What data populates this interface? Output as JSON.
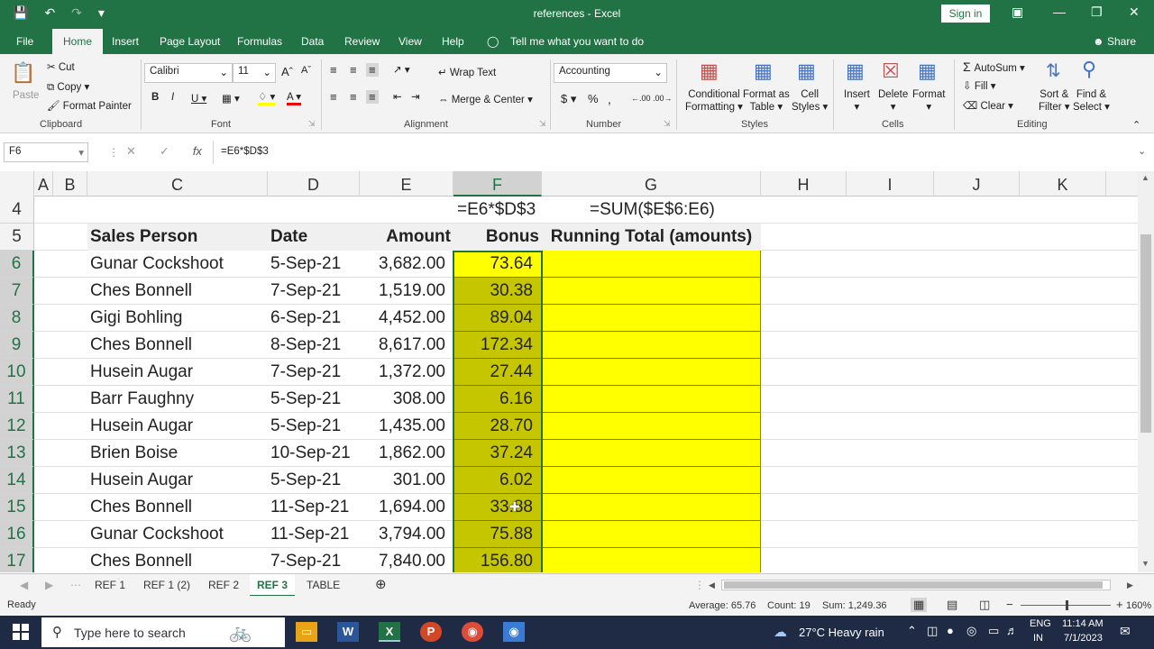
{
  "title": {
    "filename": "references",
    "app": "Excel",
    "full": "references - Excel",
    "signin": "Sign in"
  },
  "ribbon_tabs": [
    "File",
    "Home",
    "Insert",
    "Page Layout",
    "Formulas",
    "Data",
    "Review",
    "View",
    "Help",
    "Tell me what you want to do",
    "Share"
  ],
  "ribbon": {
    "clipboard": {
      "paste": "Paste",
      "cut": "Cut",
      "copy": "Copy",
      "format_painter": "Format Painter",
      "label": "Clipboard"
    },
    "font": {
      "name": "Calibri",
      "size": "11",
      "label": "Font"
    },
    "alignment": {
      "wrap": "Wrap Text",
      "merge": "Merge & Center",
      "label": "Alignment"
    },
    "number": {
      "format": "Accounting",
      "label": "Number"
    },
    "styles": {
      "cond1": "Conditional",
      "cond2": "Formatting",
      "table1": "Format as",
      "table2": "Table",
      "cell1": "Cell",
      "cell2": "Styles",
      "label": "Styles"
    },
    "cells": {
      "insert": "Insert",
      "delete": "Delete",
      "format": "Format",
      "label": "Cells"
    },
    "editing": {
      "autosum": "AutoSum",
      "fill": "Fill",
      "clear": "Clear",
      "sort1": "Sort &",
      "sort2": "Filter",
      "find1": "Find &",
      "find2": "Select",
      "label": "Editing"
    }
  },
  "namebox": "F6",
  "formula": "=E6*$D$3",
  "columns": [
    "A",
    "B",
    "C",
    "D",
    "E",
    "F",
    "G",
    "H",
    "I",
    "J",
    "K"
  ],
  "row_numbers": [
    "4",
    "5",
    "6",
    "7",
    "8",
    "9",
    "10",
    "11",
    "12",
    "13",
    "14",
    "15",
    "16",
    "17"
  ],
  "notes": {
    "f4": "=E6*$D$3",
    "g4": "=SUM($E$6:E6)"
  },
  "headers": {
    "c": "Sales Person",
    "d": "Date",
    "e": "Amount",
    "f": "Bonus",
    "g": "Running Total (amounts)"
  },
  "rows": [
    {
      "name": "Gunar Cockshoot",
      "date": "5-Sep-21",
      "amount": "3,682.00",
      "bonus": "73.64"
    },
    {
      "name": "Ches Bonnell",
      "date": "7-Sep-21",
      "amount": "1,519.00",
      "bonus": "30.38"
    },
    {
      "name": "Gigi Bohling",
      "date": "6-Sep-21",
      "amount": "4,452.00",
      "bonus": "89.04"
    },
    {
      "name": "Ches Bonnell",
      "date": "8-Sep-21",
      "amount": "8,617.00",
      "bonus": "172.34"
    },
    {
      "name": "Husein Augar",
      "date": "7-Sep-21",
      "amount": "1,372.00",
      "bonus": "27.44"
    },
    {
      "name": "Barr Faughny",
      "date": "5-Sep-21",
      "amount": "308.00",
      "bonus": "6.16"
    },
    {
      "name": "Husein Augar",
      "date": "5-Sep-21",
      "amount": "1,435.00",
      "bonus": "28.70"
    },
    {
      "name": "Brien Boise",
      "date": "10-Sep-21",
      "amount": "1,862.00",
      "bonus": "37.24"
    },
    {
      "name": "Husein Augar",
      "date": "5-Sep-21",
      "amount": "301.00",
      "bonus": "6.02"
    },
    {
      "name": "Ches Bonnell",
      "date": "11-Sep-21",
      "amount": "1,694.00",
      "bonus": "33.88"
    },
    {
      "name": "Gunar Cockshoot",
      "date": "11-Sep-21",
      "amount": "3,794.00",
      "bonus": "75.88"
    },
    {
      "name": "Ches Bonnell",
      "date": "7-Sep-21",
      "amount": "7,840.00",
      "bonus": "156.80"
    }
  ],
  "sheets": [
    "REF 1",
    "REF 1 (2)",
    "REF 2",
    "REF 3",
    "TABLE"
  ],
  "active_sheet": "REF 3",
  "status": {
    "ready": "Ready",
    "average": "Average: 65.76",
    "count": "Count: 19",
    "sum": "Sum: 1,249.36",
    "zoom": "160%"
  },
  "taskbar": {
    "search": "Type here to search",
    "weather": "27°C  Heavy rain",
    "lang1": "ENG",
    "lang2": "IN",
    "time": "11:14 AM",
    "date": "7/1/2023"
  },
  "colors": {
    "excel_green": "#217346",
    "highlight_yellow": "#ffff00",
    "selection": "#c5c500"
  }
}
